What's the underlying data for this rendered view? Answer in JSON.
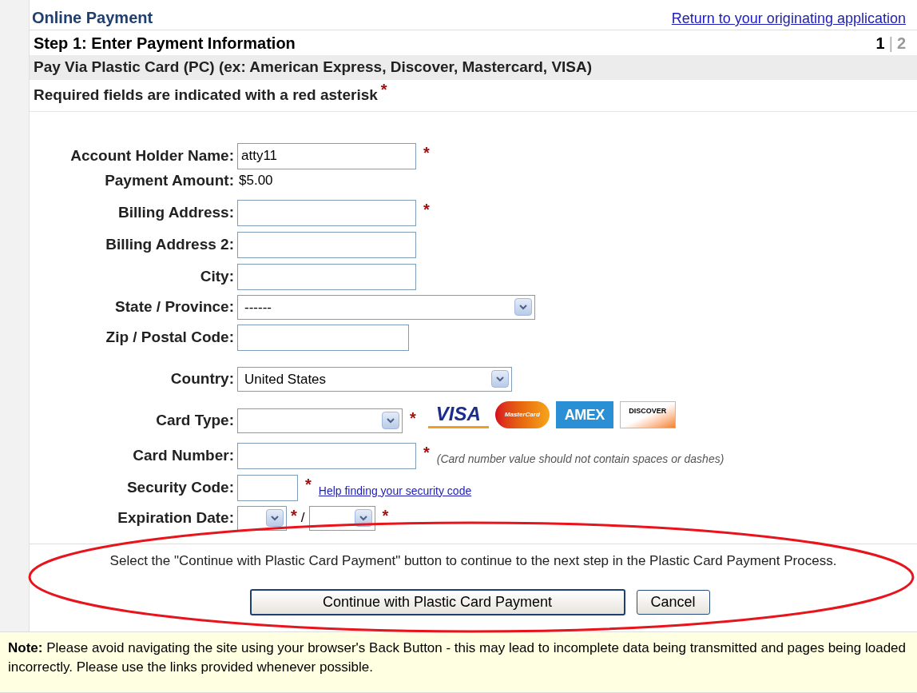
{
  "header": {
    "title": "Online Payment",
    "return_link": "Return to your originating application"
  },
  "step": {
    "title": "Step 1: Enter Payment Information",
    "steps": [
      {
        "label": "1",
        "selected": true
      },
      {
        "label": "2",
        "selected": false
      }
    ],
    "separator": "|"
  },
  "section_title": "Pay Via Plastic Card (PC) (ex: American Express, Discover, Mastercard, VISA)",
  "required_note": {
    "text": "Required fields are indicated with a red asterisk",
    "asterisk": "*"
  },
  "fields": [
    {
      "kind": "text",
      "label": "Account Holder Name:",
      "value": "atty11",
      "required": true
    },
    {
      "kind": "static",
      "label": "Payment Amount:",
      "value": "$5.00",
      "required": false
    },
    {
      "kind": "text",
      "label": "Billing Address:",
      "required": true
    },
    {
      "kind": "text",
      "label": "Billing Address 2:",
      "required": false
    },
    {
      "kind": "text",
      "label": "City:",
      "required": false
    },
    {
      "kind": "select",
      "label": "State / Province:",
      "value": "------",
      "required": false
    },
    {
      "kind": "text",
      "label": "Zip / Postal Code:",
      "required": false
    },
    {
      "kind": "select",
      "label": "Country:",
      "value": "United States",
      "required": false
    },
    {
      "kind": "select",
      "label": "Card Type:",
      "required": true,
      "logos": [
        {
          "kind": "visa",
          "text": "VISA"
        },
        {
          "kind": "mastercard",
          "text": "MasterCard"
        },
        {
          "kind": "amex",
          "text": "AMEX"
        },
        {
          "kind": "discover",
          "text": "DISCOVER"
        }
      ]
    },
    {
      "kind": "text",
      "label": "Card Number:",
      "required": true,
      "hint": "(Card number value should not contain spaces or dashes)"
    },
    {
      "kind": "text",
      "label": "Security Code:",
      "required": true,
      "link": "Help finding your security code"
    },
    {
      "kind": "expiry",
      "label": "Expiration Date:",
      "required": true,
      "separator": "/"
    }
  ],
  "instructions": "Select the \"Continue with Plastic Card Payment\" button to continue to the next step in the Plastic Card Payment Process.",
  "buttons": [
    {
      "kind": "primary",
      "label": "Continue with Plastic Card Payment"
    },
    {
      "kind": "secondary",
      "label": "Cancel"
    }
  ],
  "highlight": true,
  "note": "**Note:** Please avoid navigating the site using your browser's Back Button - this may lead to incomplete data being transmitted and pages being loaded incorrectly. Please use the links provided whenever possible."
}
